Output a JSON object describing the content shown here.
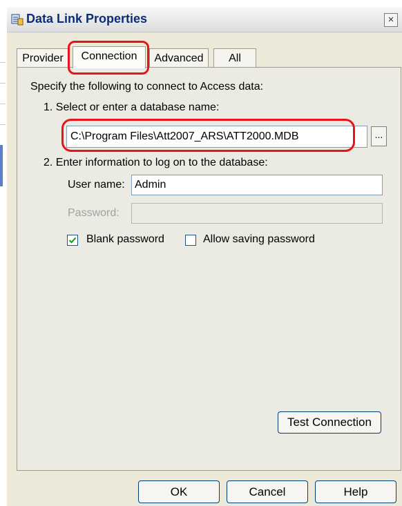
{
  "window": {
    "title": "Data Link Properties",
    "close_symbol": "×"
  },
  "tabs": [
    {
      "label": "Provider",
      "active": false
    },
    {
      "label": "Connection",
      "active": true
    },
    {
      "label": "Advanced",
      "active": false
    },
    {
      "label": "All",
      "active": false
    }
  ],
  "connection": {
    "intro": "Specify the following to connect to Access data:",
    "step1_label": "1. Select or enter a database name:",
    "database_path": "C:\\Program Files\\Att2007_ARS\\ATT2000.MDB",
    "browse_label": "...",
    "step2_label": "2. Enter information to log on to the database:",
    "username_label": "User name:",
    "username_value": "Admin",
    "password_label": "Password:",
    "password_value": "",
    "blank_password_label": "Blank password",
    "blank_password_checked": true,
    "allow_saving_label": "Allow saving password",
    "allow_saving_checked": false,
    "test_connection_label": "Test Connection"
  },
  "footer": {
    "ok_label": "OK",
    "cancel_label": "Cancel",
    "help_label": "Help"
  },
  "colors": {
    "highlight": "#e8121b",
    "title_text": "#0b2d7a",
    "panel": "#ecebe3"
  }
}
